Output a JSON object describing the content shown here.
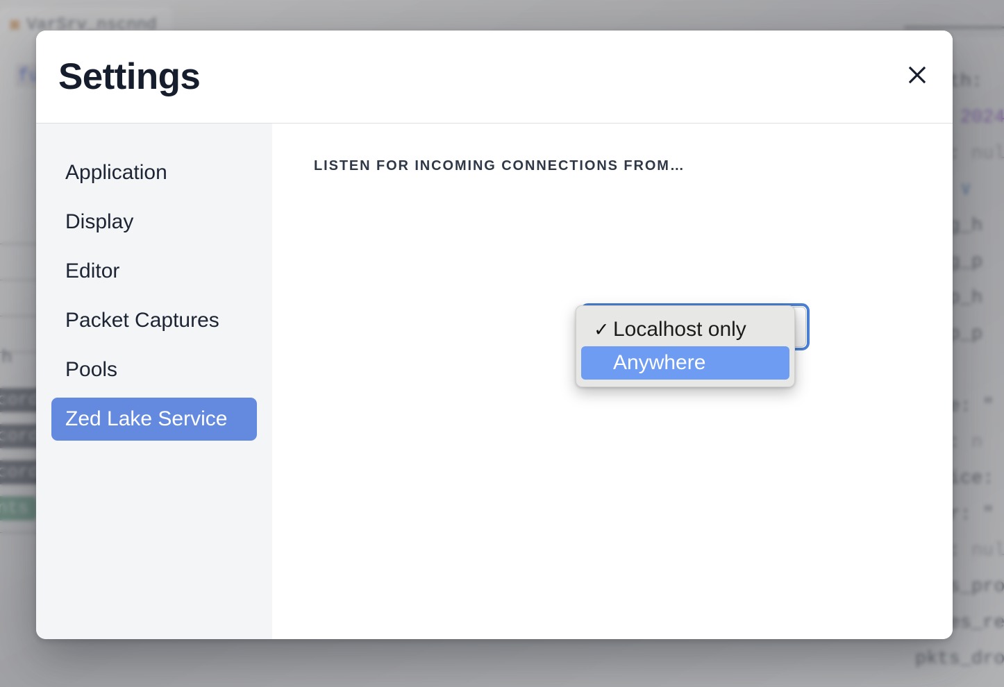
{
  "background": {
    "tab": {
      "icon": "▣",
      "label": "VarSrv_nscnnd"
    },
    "code_snippet": "fu",
    "table_rows": [
      {
        "badge": "record",
        "badge_kind": "dark"
      },
      {
        "badge": "record",
        "badge_kind": "dark"
      },
      {
        "badge": "record",
        "badge_kind": "dark"
      },
      {
        "badge": "uints",
        "badge_kind": "green"
      }
    ],
    "table_text": "h",
    "json_lines": [
      {
        "key": "_path:",
        "value": "",
        "kind": "plain"
      },
      {
        "key": "ts:",
        "value": "2024",
        "kind": "num"
      },
      {
        "key": "uid:",
        "value": "null",
        "kind": "null"
      },
      {
        "key": "id:",
        "value": "∨",
        "kind": "chev"
      },
      {
        "key": "orig_h",
        "value": "",
        "kind": "plain"
      },
      {
        "key": "orig_p",
        "value": "",
        "kind": "plain"
      },
      {
        "key": "resp_h",
        "value": "",
        "kind": "plain"
      },
      {
        "key": "resp_p",
        "value": "",
        "kind": "plain"
      },
      {
        "key": "name:",
        "value": "\"",
        "kind": "str"
      },
      {
        "key": "ttl:",
        "value": "n",
        "kind": "null"
      },
      {
        "key": "notice:",
        "value": "",
        "kind": "plain"
      },
      {
        "key": "peer:",
        "value": "\"",
        "kind": "str"
      },
      {
        "key": "son:",
        "value": "null",
        "kind": "null"
      },
      {
        "key": "pkts_pro",
        "value": "",
        "kind": "plain"
      },
      {
        "key": "bytes_re",
        "value": "",
        "kind": "plain"
      },
      {
        "key": "pkts_dro",
        "value": "",
        "kind": "plain"
      }
    ]
  },
  "modal": {
    "title": "Settings",
    "close_icon": "close-icon",
    "sidebar": {
      "items": [
        {
          "label": "Application",
          "active": false
        },
        {
          "label": "Display",
          "active": false
        },
        {
          "label": "Editor",
          "active": false
        },
        {
          "label": "Packet Captures",
          "active": false
        },
        {
          "label": "Pools",
          "active": false
        },
        {
          "label": "Zed Lake Service",
          "active": true
        }
      ]
    },
    "content": {
      "field_label": "Listen for incoming connections from…",
      "select": {
        "value": "Localhost only",
        "focused": true,
        "open": true,
        "options": [
          {
            "label": "Localhost only",
            "checked": true,
            "highlighted": false
          },
          {
            "label": "Anywhere",
            "checked": false,
            "highlighted": true
          }
        ]
      }
    }
  },
  "colors": {
    "accent_blue": "#648ae0",
    "highlight_blue": "#6d9cf2",
    "focus_ring": "#4a7fd4",
    "title_navy": "#161d2c",
    "sidebar_bg": "#f4f5f6",
    "popup_bg": "#e7e7e6"
  }
}
